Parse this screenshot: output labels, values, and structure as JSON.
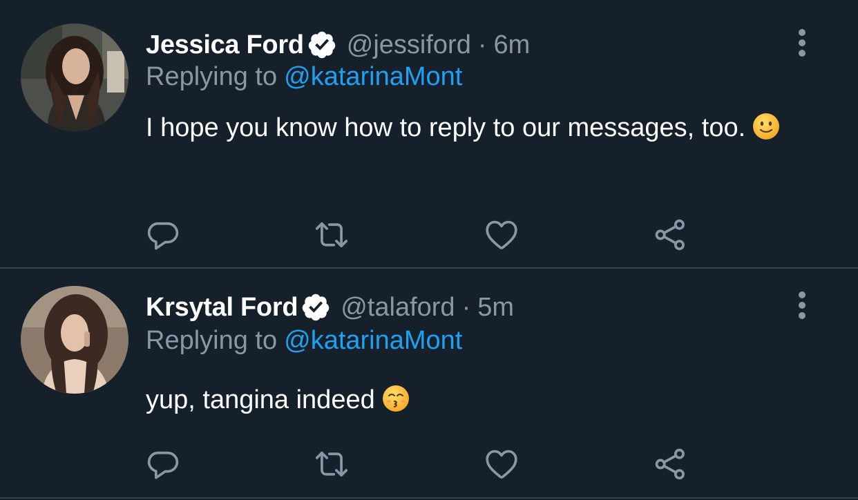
{
  "colors": {
    "background": "#15202b",
    "divider": "#38444d",
    "secondary_text": "#8899a6",
    "link": "#1da1f2",
    "primary_text": "#ffffff"
  },
  "tweets": [
    {
      "name": "Jessica Ford",
      "verified": true,
      "handle": "@jessiford",
      "separator": "·",
      "time": "6m",
      "replying_label": "Replying to",
      "replying_to": "@katarinaMont",
      "text": "I hope you know how to reply to our messages, too.",
      "emoji": "slightly-smiling-face",
      "icons": [
        "reply-icon",
        "retweet-icon",
        "like-icon",
        "share-icon",
        "more-icon"
      ]
    },
    {
      "name": "Krsytal Ford",
      "verified": true,
      "handle": "@talaford",
      "separator": "·",
      "time": "5m",
      "replying_label": "Replying to",
      "replying_to": "@katarinaMont",
      "text": "yup, tangina indeed",
      "emoji": "kissing-face",
      "icons": [
        "reply-icon",
        "retweet-icon",
        "like-icon",
        "share-icon",
        "more-icon"
      ]
    }
  ]
}
